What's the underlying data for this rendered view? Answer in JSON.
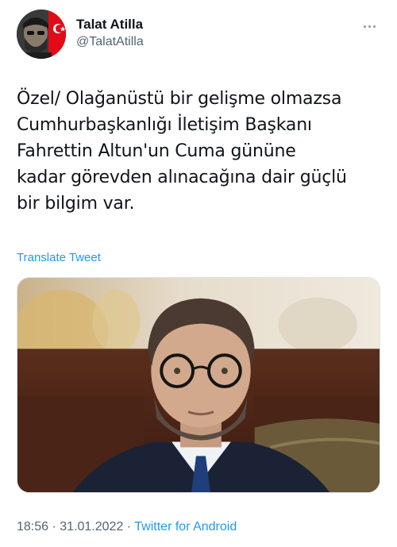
{
  "user": {
    "display_name": "Talat Atilla",
    "handle": "@TalatAtilla"
  },
  "icons": {
    "more": "more-dots-icon",
    "flag": "turkish-flag-icon"
  },
  "tweet": {
    "text": "Özel/ Olağanüstü bir gelişme olmazsa\nCumhurbaşkanlığı İletişim Başkanı\nFahrettin Altun'un Cuma gününe\nkadar görevden alınacağına dair güçlü\nbir bilgim var.",
    "translate_label": "Translate Tweet"
  },
  "meta": {
    "time": "18:56",
    "separator1": " · ",
    "date": "31.01.2022",
    "separator2": " · ",
    "source": "Twitter for Android"
  },
  "colors": {
    "link": "#1d9bf0",
    "secondary_text": "#536471",
    "flag_red": "#e30a17"
  }
}
